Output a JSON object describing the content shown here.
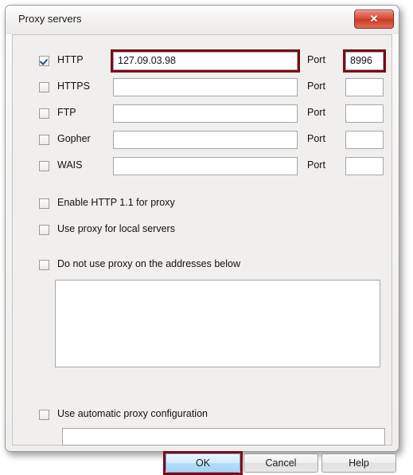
{
  "window": {
    "title": "Proxy servers",
    "close_icon": "✕",
    "close_icon_name": "close-icon"
  },
  "colors": {
    "highlight": "#7b0a18",
    "accent_button": "#b4dcf7",
    "close_button": "#d9503a",
    "dialog_bg": "#f0efed"
  },
  "proxy_rows": [
    {
      "label": "HTTP",
      "checked": true,
      "address": "127.09.03.98",
      "port": "8996",
      "port_label": "Port",
      "highlight_address": true,
      "highlight_port": true
    },
    {
      "label": "HTTPS",
      "checked": false,
      "address": "",
      "port": "",
      "port_label": "Port",
      "highlight_address": false,
      "highlight_port": false
    },
    {
      "label": "FTP",
      "checked": false,
      "address": "",
      "port": "",
      "port_label": "Port",
      "highlight_address": false,
      "highlight_port": false
    },
    {
      "label": "Gopher",
      "checked": false,
      "address": "",
      "port": "",
      "port_label": "Port",
      "highlight_address": false,
      "highlight_port": false
    },
    {
      "label": "WAIS",
      "checked": false,
      "address": "",
      "port": "",
      "port_label": "Port",
      "highlight_address": false,
      "highlight_port": false
    }
  ],
  "options": [
    {
      "label": "Enable HTTP 1.1 for proxy",
      "checked": false
    },
    {
      "label": "Use proxy for local servers",
      "checked": false
    },
    {
      "label": "Do not use proxy on the addresses below",
      "checked": false
    }
  ],
  "exceptions": {
    "value": "",
    "scrollbar_up": "▲",
    "scrollbar_down": "▼"
  },
  "autoconfig": {
    "checkbox_label": "Use automatic proxy configuration",
    "checked": false,
    "value": ""
  },
  "buttons": {
    "ok": "OK",
    "cancel": "Cancel",
    "help": "Help"
  }
}
